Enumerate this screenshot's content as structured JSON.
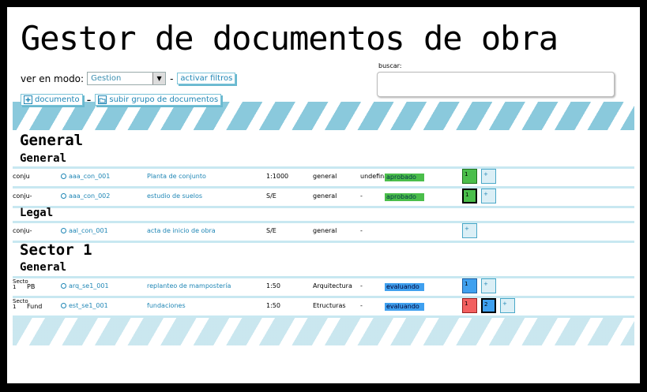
{
  "app": {
    "title": "Gestor de documentos de obra"
  },
  "toolbar": {
    "mode_label": "ver en modo:",
    "mode_value": "Gestion",
    "separator": "-",
    "filters_button": "activar filtros",
    "document_button": "documento",
    "upload_group_button": "subir grupo de documentos"
  },
  "search": {
    "label": "buscar:",
    "value": ""
  },
  "sections": [
    {
      "title": "General",
      "groups": [
        {
          "title": "General",
          "rows": [
            {
              "short": "conju",
              "code": "aaa_con_001",
              "title": "Planta de conjunto",
              "scale": "1:1000",
              "discipline": "general",
              "phase": "undefina",
              "status": "aprobado",
              "status_color": "#4bbe4b",
              "versions": [
                "1"
              ],
              "add": "+"
            },
            {
              "short": "conju-",
              "code": "aaa_con_002",
              "title": "estudio de suelos",
              "scale": "S/E",
              "discipline": "general",
              "phase": "-",
              "status": "aprobado",
              "status_color": "#4bbe4b",
              "versions": [
                "1"
              ],
              "add": "+"
            }
          ]
        },
        {
          "title": "Legal",
          "rows": [
            {
              "short": "conju-",
              "code": "aal_con_001",
              "title": "acta de inicio de obra",
              "scale": "S/E",
              "discipline": "general",
              "phase": "-",
              "status": "",
              "versions": [],
              "add": "+"
            }
          ]
        }
      ]
    },
    {
      "title": "Sector 1",
      "groups": [
        {
          "title": "General",
          "rows": [
            {
              "short_top": "Secto",
              "short_bottom": "1",
              "short_name": "PB",
              "code": "arq_se1_001",
              "title": "replanteo de mampostería",
              "scale": "1:50",
              "discipline": "Arquitectura",
              "phase": "-",
              "status": "evaluando",
              "status_color": "#3fa0ef",
              "versions": [
                "1"
              ],
              "add": "+"
            },
            {
              "short_top": "Secto",
              "short_bottom": "1",
              "short_name": "Fund",
              "code": "est_se1_001",
              "title": "fundaciones",
              "scale": "1:50",
              "discipline": "Etructuras",
              "phase": "-",
              "status": "evaluando",
              "status_color": "#3fa0ef",
              "versions": [
                "1",
                "2"
              ],
              "add": "+"
            }
          ]
        }
      ]
    }
  ],
  "colors": {
    "accent": "#1f86b5",
    "stripe": "#8ac9dc",
    "approved": "#4bbe4b",
    "evaluating": "#3fa0ef",
    "rejected": "#f26060"
  }
}
